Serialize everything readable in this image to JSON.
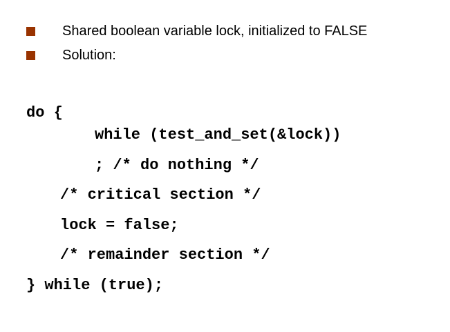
{
  "bullets": [
    {
      "text": "Shared boolean variable lock, initialized to FALSE"
    },
    {
      "text": "Solution:"
    }
  ],
  "code": [
    "do {",
    "while (test_and_set(&lock))",
    "; /* do nothing */",
    "/* critical section */",
    "lock = false;",
    "/* remainder section */",
    "} while (true);"
  ],
  "colors": {
    "bullet": "#993300",
    "text": "#000000",
    "background": "#ffffff"
  }
}
